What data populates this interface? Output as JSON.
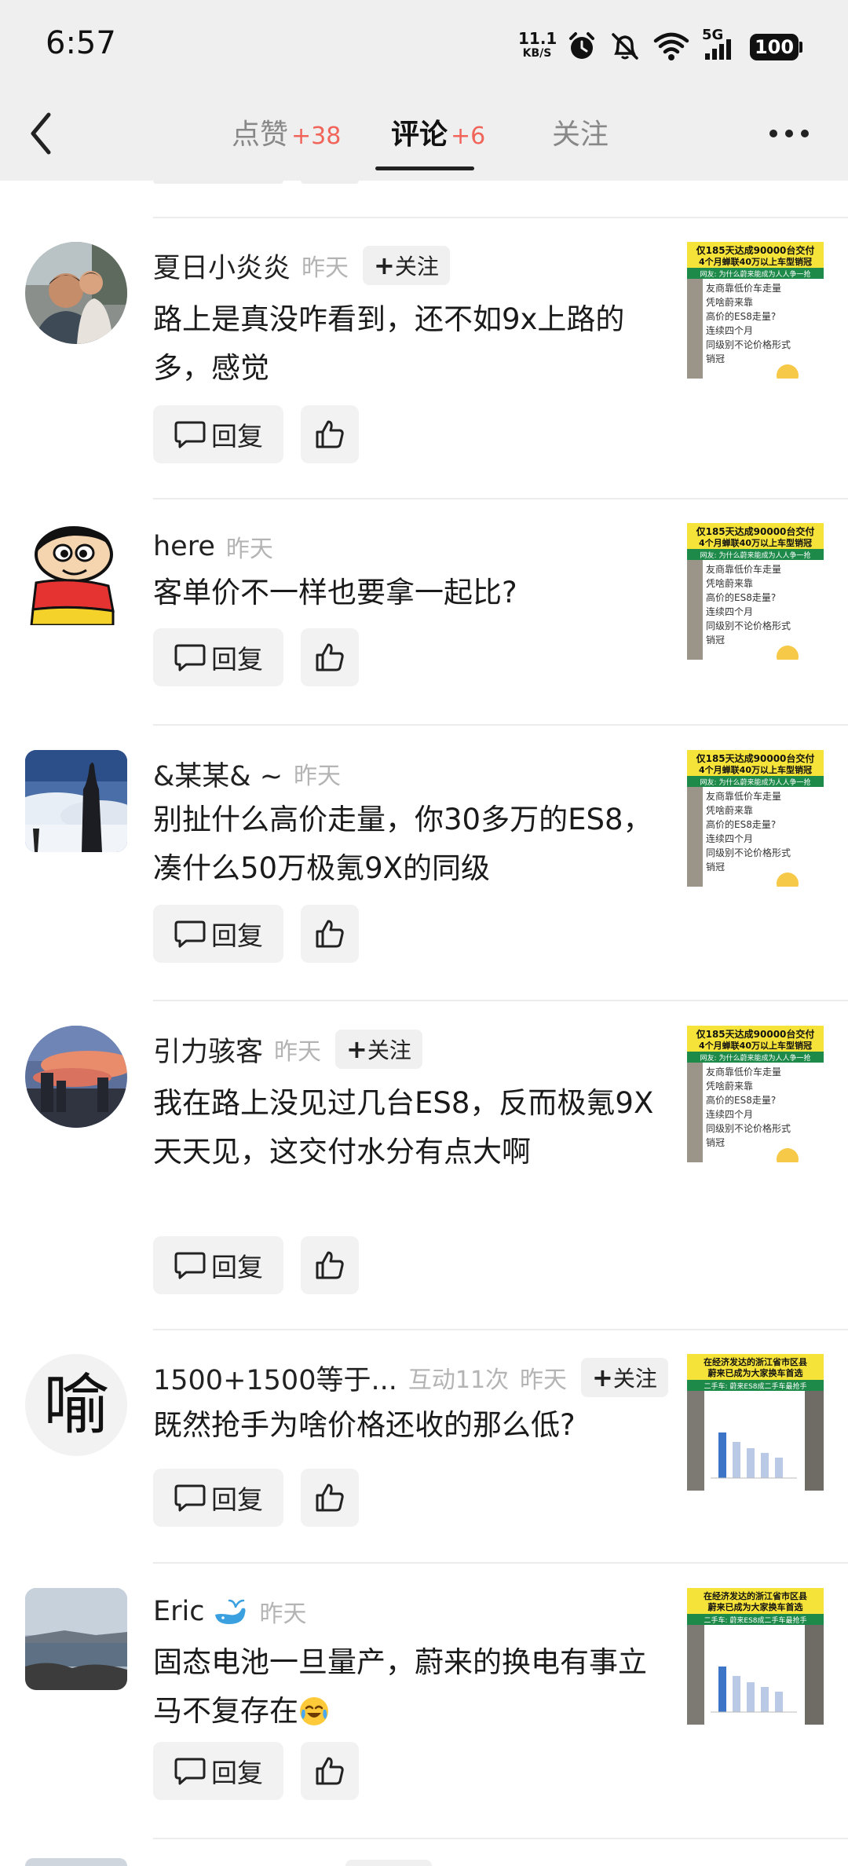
{
  "status_bar": {
    "time": "6:57",
    "net_speed_value": "11.1",
    "net_speed_unit": "KB/S",
    "signal_label": "5G",
    "battery": "100"
  },
  "header": {
    "tabs": [
      {
        "label": "点赞",
        "count": "+38",
        "active": false
      },
      {
        "label": "评论",
        "count": "+6",
        "active": true
      },
      {
        "label": "关注",
        "count": "",
        "active": false
      }
    ]
  },
  "comments": [
    {
      "username": "夏日小炎炎",
      "time": "昨天",
      "interactions": "",
      "follow_label": "关注",
      "text": "路上是真没咋看到，还不如9x上路的多，感觉",
      "reply_label": "回复"
    },
    {
      "username": "here",
      "time": "昨天",
      "interactions": "",
      "follow_label": "",
      "text": "客单价不一样也要拿一起比?",
      "reply_label": "回复"
    },
    {
      "username": "&某某& ~",
      "time": "昨天",
      "interactions": "",
      "follow_label": "",
      "text": "别扯什么高价走量，你30多万的ES8，凑什么50万极氪9X的同级",
      "reply_label": "回复"
    },
    {
      "username": "引力骇客",
      "time": "昨天",
      "interactions": "",
      "follow_label": "关注",
      "text": "我在路上没见过几台ES8，反而极氪9X天天见，这交付水分有点大啊",
      "reply_label": "回复"
    },
    {
      "username": "1500+1500等于...",
      "time": "昨天",
      "interactions": "互动11次",
      "follow_label": "关注",
      "text": "既然抢手为啥价格还收的那么低?",
      "reply_label": "回复"
    },
    {
      "username": "Eric",
      "time": "昨天",
      "interactions": "",
      "follow_label": "",
      "text": "固态电池一旦量产，蔚来的换电有事立马不复存在",
      "reply_label": "回复"
    }
  ],
  "avatar_glyph": "喻",
  "thumbnails": {
    "a_title": "仅185天达成90000台交付",
    "a_subtitle": "4个月蝉联40万以上车型销冠",
    "a_banner": "网友: 为什么蔚来能成为人人争一抢",
    "a_lines": [
      "友商靠低价车走量",
      "凭啥蔚来靠",
      "高价的ES8走量?",
      "连续四个月",
      "同级别不论价格形式",
      "销冠"
    ],
    "b_title": "在经济发达的浙江省市区县",
    "b_subtitle": "蔚来已成为大家换车首选",
    "b_banner": "二手车: 蔚来ES8成二手车最抢手",
    "colors": {
      "accent_red": "#f0645a",
      "thumb_yellow": "#f6e33a",
      "thumb_green": "#1d8a4a"
    }
  }
}
